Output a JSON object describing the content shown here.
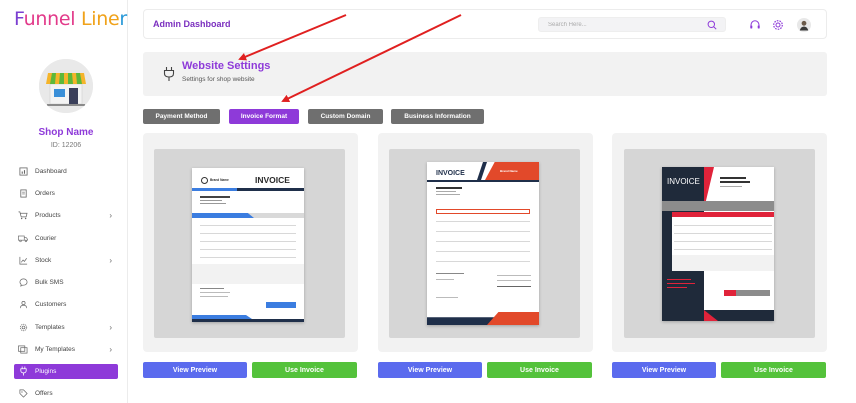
{
  "app": {
    "logo_text": "FunnelLiner",
    "logo_parts": [
      "F",
      "unnel",
      " Line",
      "r"
    ]
  },
  "sidebar": {
    "shop_name": "Shop Name",
    "shop_id": "ID: 12206",
    "items": [
      {
        "label": "Dashboard",
        "icon": "dashboard-icon",
        "chevron": false
      },
      {
        "label": "Orders",
        "icon": "orders-icon",
        "chevron": false
      },
      {
        "label": "Products",
        "icon": "cart-icon",
        "chevron": true
      },
      {
        "label": "Courier",
        "icon": "truck-icon",
        "chevron": false
      },
      {
        "label": "Stock",
        "icon": "chart-icon",
        "chevron": true
      },
      {
        "label": "Bulk SMS",
        "icon": "message-icon",
        "chevron": false
      },
      {
        "label": "Customers",
        "icon": "customers-icon",
        "chevron": false
      },
      {
        "label": "Templates",
        "icon": "gear-icon",
        "chevron": true
      },
      {
        "label": "My Templates",
        "icon": "templates-icon",
        "chevron": true
      },
      {
        "label": "Plugins",
        "icon": "plug-icon",
        "chevron": false,
        "active": true
      },
      {
        "label": "Offers",
        "icon": "offers-icon",
        "chevron": false
      }
    ]
  },
  "header": {
    "title": "Admin Dashboard",
    "search_placeholder": "Search Here..."
  },
  "settings": {
    "title": "Website Settings",
    "subtitle": "Settings for shop website"
  },
  "tabs": [
    {
      "label": "Payment Method",
      "active": false
    },
    {
      "label": "Invoice Format",
      "active": true
    },
    {
      "label": "Custom Domain",
      "active": false
    },
    {
      "label": "Business Information",
      "active": false
    }
  ],
  "cards": [
    {
      "preview_label": "View Preview",
      "use_label": "Use Invoice",
      "invoice_heading": "INVOICE",
      "brand": "Brand Name"
    },
    {
      "preview_label": "View Preview",
      "use_label": "Use Invoice",
      "invoice_heading": "INVOICE",
      "brand": "Brand Name"
    },
    {
      "preview_label": "View Preview",
      "use_label": "Use Invoice",
      "invoice_heading": "INVOICE",
      "brand": "Brand Name"
    }
  ],
  "colors": {
    "accent_purple": "#8e3ad9",
    "preview_blue": "#5b6bee",
    "use_green": "#54c23b",
    "annotation_red": "#e02020",
    "invoice1_accent": "#3b7de0",
    "invoice2_accent": "#e2492a",
    "invoice3_accent": "#e0233a"
  }
}
